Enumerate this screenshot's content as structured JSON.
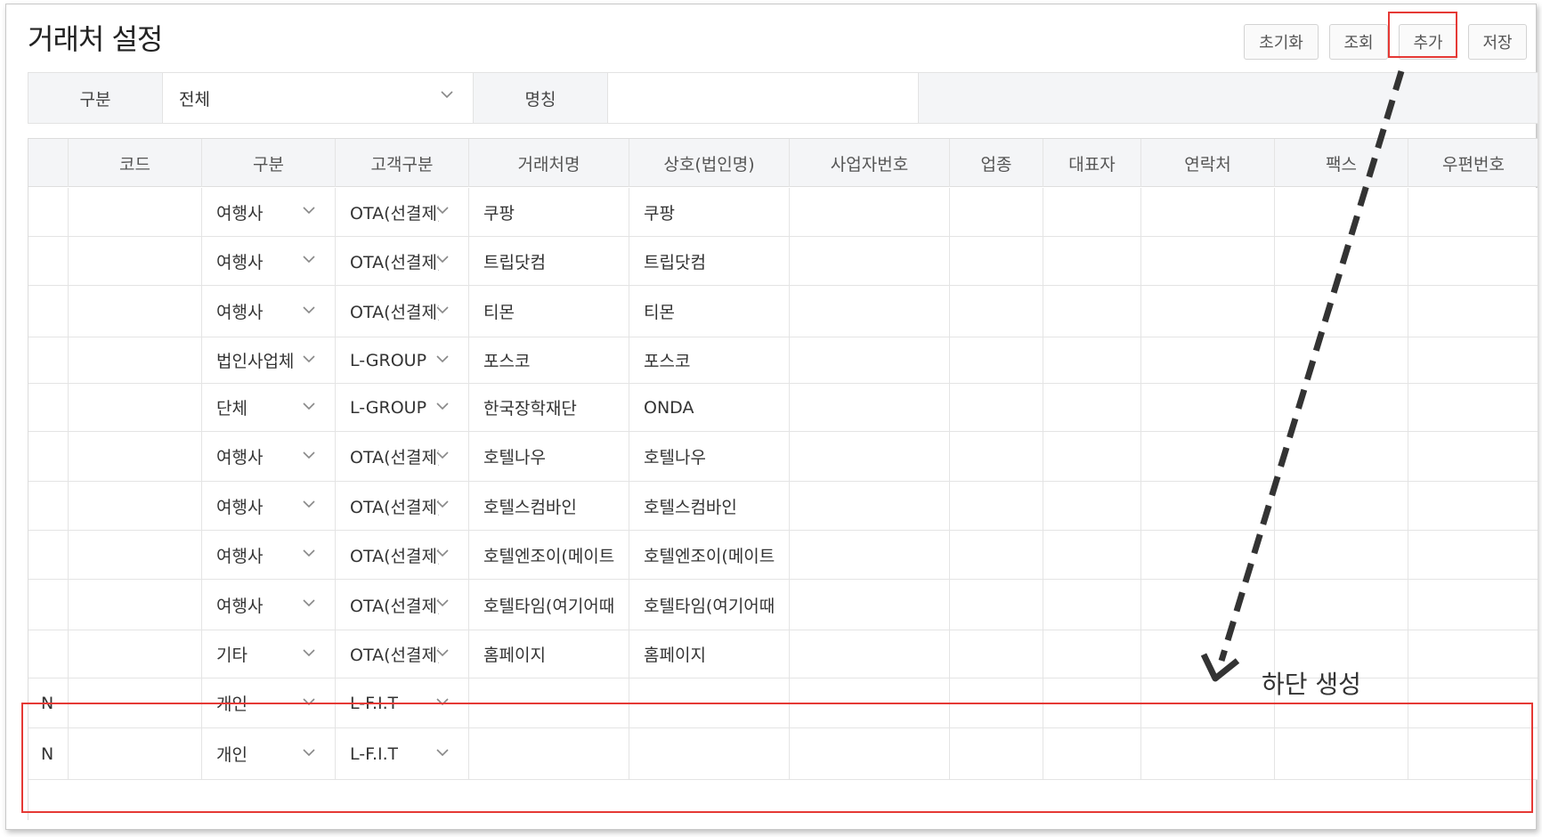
{
  "page": {
    "title": "거래처 설정"
  },
  "toolbar": {
    "reset": "초기화",
    "query": "조회",
    "add": "추가",
    "save": "저장"
  },
  "filter": {
    "type_label": "구분",
    "type_value": "전체",
    "name_label": "명칭",
    "name_value": ""
  },
  "grid": {
    "columns": [
      "",
      "코드",
      "구분",
      "고객구분",
      "거래처명",
      "상호(법인명)",
      "사업자번호",
      "업종",
      "대표자",
      "연락처",
      "팩스",
      "우편번호"
    ],
    "rows": [
      {
        "flag": "",
        "code": "",
        "type": "여행사",
        "customer_type": "OTA(선결제)",
        "name": "쿠팡",
        "corp": "쿠팡"
      },
      {
        "flag": "",
        "code": "",
        "type": "여행사",
        "customer_type": "OTA(선결제)",
        "name": "트립닷컴",
        "corp": "트립닷컴"
      },
      {
        "flag": "",
        "code": "",
        "type": "여행사",
        "customer_type": "OTA(선결제)",
        "name": "티몬",
        "corp": "티몬"
      },
      {
        "flag": "",
        "code": "",
        "type": "법인사업체",
        "customer_type": "L-GROUP",
        "name": "포스코",
        "corp": "포스코"
      },
      {
        "flag": "",
        "code": "",
        "type": "단체",
        "customer_type": "L-GROUP",
        "name": "한국장학재단",
        "corp": "ONDA"
      },
      {
        "flag": "",
        "code": "",
        "type": "여행사",
        "customer_type": "OTA(선결제)",
        "name": "호텔나우",
        "corp": "호텔나우"
      },
      {
        "flag": "",
        "code": "",
        "type": "여행사",
        "customer_type": "OTA(선결제)",
        "name": "호텔스컴바인",
        "corp": "호텔스컴바인"
      },
      {
        "flag": "",
        "code": "",
        "type": "여행사",
        "customer_type": "OTA(선결제)",
        "name": "호텔엔조이(메이트",
        "corp": "호텔엔조이(메이트"
      },
      {
        "flag": "",
        "code": "",
        "type": "여행사",
        "customer_type": "OTA(선결제)",
        "name": "호텔타임(여기어때",
        "corp": "호텔타임(여기어때"
      },
      {
        "flag": "",
        "code": "",
        "type": "기타",
        "customer_type": "OTA(선결제)",
        "name": "홈페이지",
        "corp": "홈페이지"
      },
      {
        "flag": "N",
        "code": "",
        "type": "개인",
        "customer_type": "L-F.I.T",
        "name": "",
        "corp": ""
      },
      {
        "flag": "N",
        "code": "",
        "type": "개인",
        "customer_type": "L-F.I.T",
        "name": "",
        "corp": ""
      }
    ]
  },
  "annotation": {
    "text": "하단 생성",
    "color": "#e53935"
  },
  "icons": {
    "dropdown": "chevron-down-icon"
  }
}
